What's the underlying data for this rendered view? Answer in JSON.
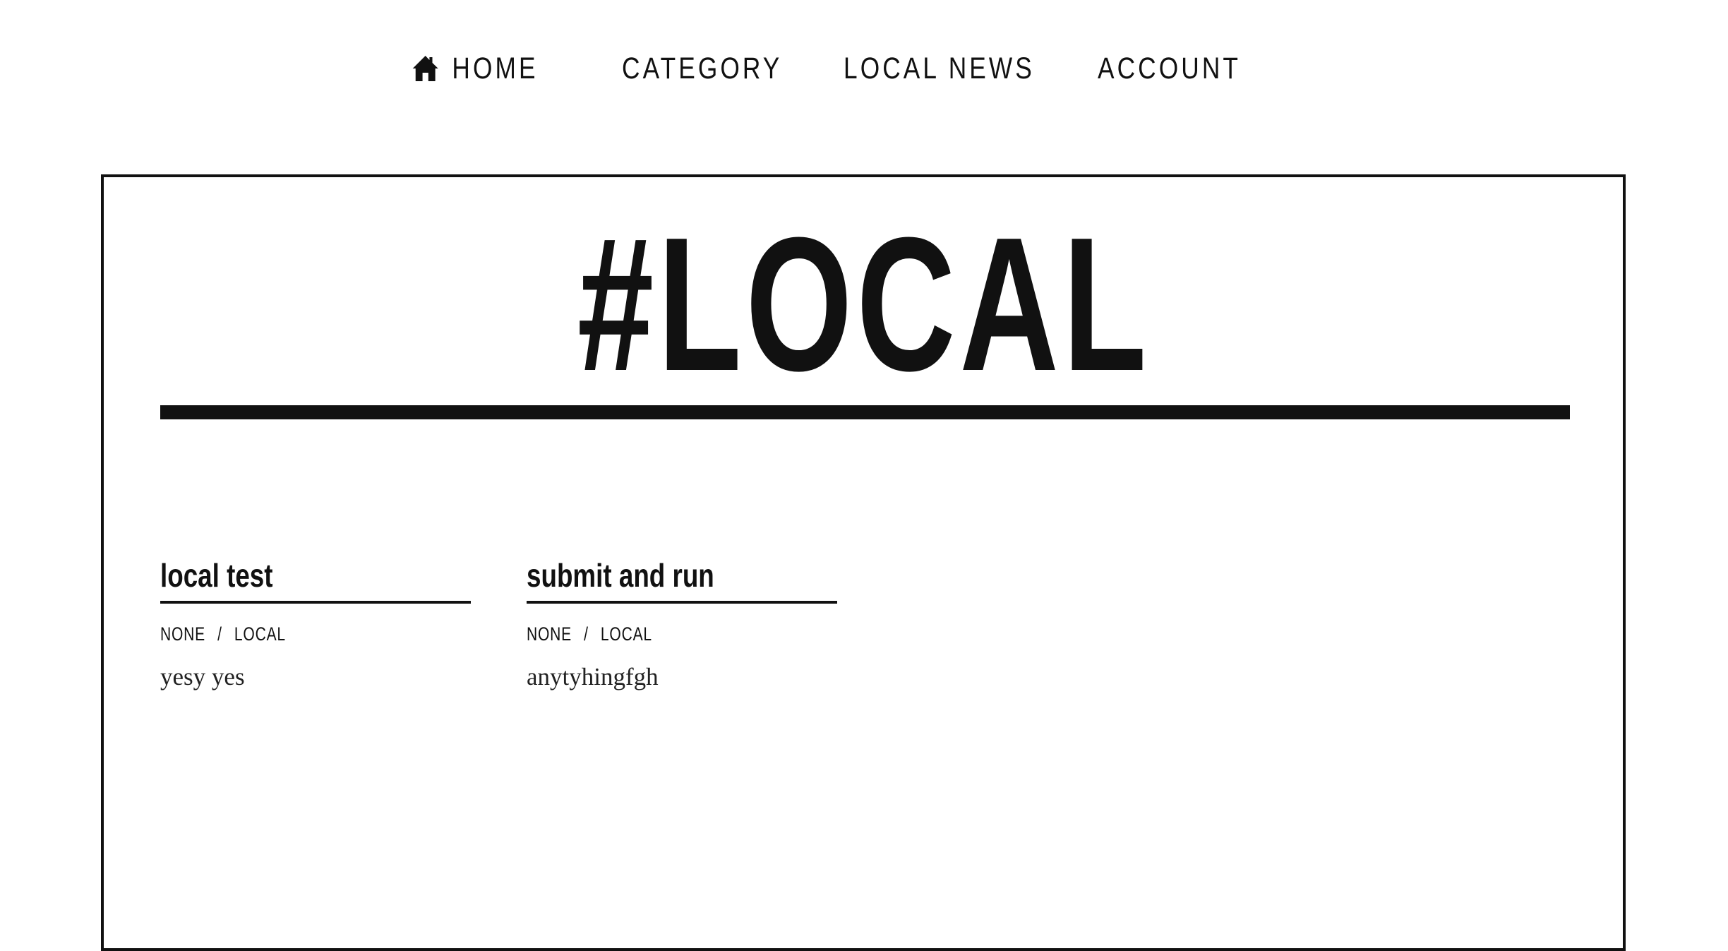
{
  "nav": {
    "home_icon": "home-icon",
    "items": [
      {
        "label": "HOME"
      },
      {
        "label": "CATEGORY"
      },
      {
        "label": "LOCAL NEWS"
      },
      {
        "label": "ACCOUNT"
      }
    ]
  },
  "page": {
    "title": "#LOCAL"
  },
  "posts": [
    {
      "title": "local test",
      "meta": [
        "NONE",
        "LOCAL"
      ],
      "separator": "/",
      "excerpt": "yesy yes"
    },
    {
      "title": "submit and run",
      "meta": [
        "NONE",
        "LOCAL"
      ],
      "separator": "/",
      "excerpt": "anytyhingfgh"
    }
  ],
  "colors": {
    "text": "#111111",
    "background": "#ffffff"
  }
}
